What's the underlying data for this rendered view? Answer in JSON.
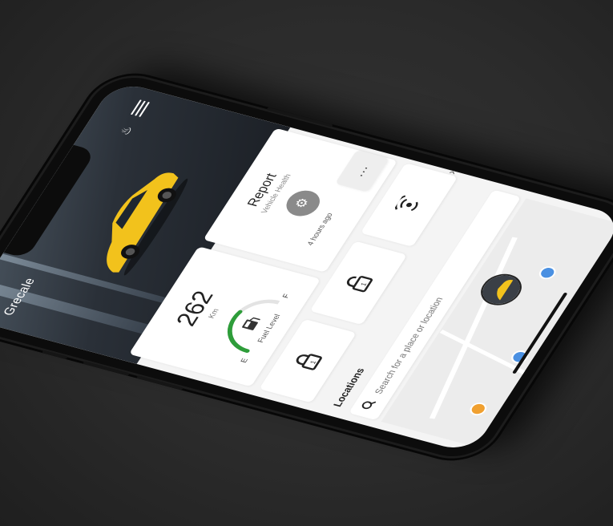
{
  "header": {
    "brand": "Grecale"
  },
  "range": {
    "value": "262",
    "unit": "Km"
  },
  "fuel": {
    "empty_label": "E",
    "full_label": "F",
    "label": "Fuel Level",
    "level": 0.6
  },
  "report": {
    "title": "Report",
    "subtitle": "Vehicle Health",
    "time": "4 hours ago"
  },
  "more": {
    "label": "..."
  },
  "locations": {
    "title": "Locations",
    "placeholder": "Search for a place or location"
  },
  "colors": {
    "accent": "#2e9d3a",
    "car": "#f2c21c",
    "pin": "#4a90e2"
  }
}
